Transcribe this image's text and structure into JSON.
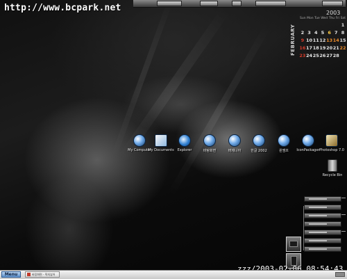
{
  "watermark": {
    "url": "http://www.bcpark.net"
  },
  "calendar": {
    "year": "2003",
    "month": "FEBRUARY",
    "weekdays": [
      "Sun",
      "Mon",
      "Tue",
      "Wed",
      "Thu",
      "Fri",
      "Sat"
    ],
    "weeks": [
      [
        "",
        "",
        "",
        "",
        "",
        "",
        "1"
      ],
      [
        "2",
        "3",
        "4",
        "5",
        "6",
        "7",
        "8"
      ],
      [
        "9",
        "10",
        "11",
        "12",
        "13",
        "14",
        "15"
      ],
      [
        "16",
        "17",
        "18",
        "19",
        "20",
        "21",
        "22"
      ],
      [
        "23",
        "24",
        "25",
        "26",
        "27",
        "28",
        ""
      ]
    ]
  },
  "desktop_icons": [
    {
      "label": "My Computer",
      "icon": "computer-icon"
    },
    {
      "label": "My Documents",
      "icon": "folder-icon"
    },
    {
      "label": "Explorer",
      "icon": "internet-explorer-icon"
    },
    {
      "label": "바탕화면",
      "icon": "orb-icon"
    },
    {
      "label": "버제니아",
      "icon": "orb-icon"
    },
    {
      "label": "한글 2002",
      "icon": "orb-icon"
    },
    {
      "label": "윈앰프",
      "icon": "orb-icon"
    },
    {
      "label": "IconPackager",
      "icon": "orb-icon"
    },
    {
      "label": "Photoshop 7.0",
      "icon": "photoshop-icon"
    },
    {
      "label": "Recycle Bin",
      "icon": "recycle-bin-icon"
    }
  ],
  "clock": {
    "text": "zzz/2003-02-06 08:54:43"
  },
  "taskbar": {
    "menu_label": "Menu",
    "task_label": "바탕화면 - 픽처뷰어"
  }
}
